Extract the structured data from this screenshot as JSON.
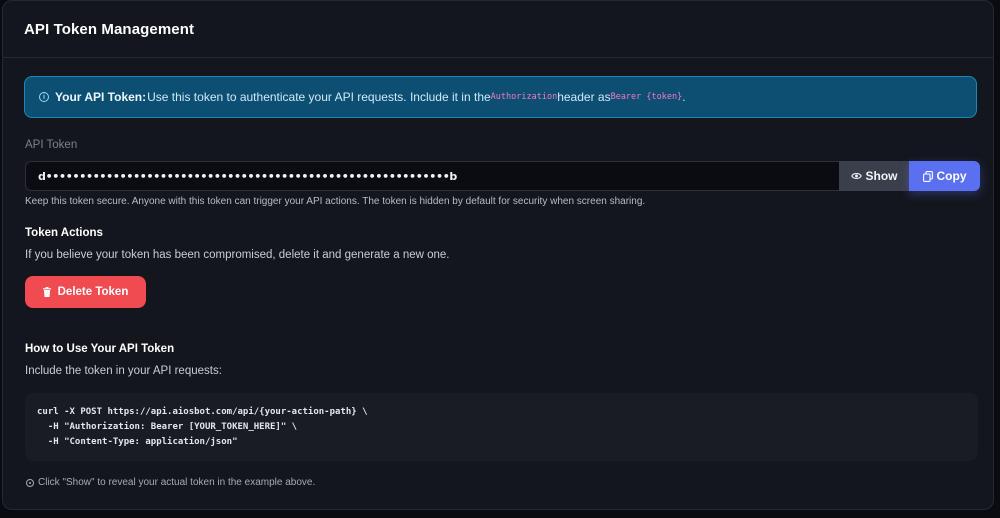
{
  "header": {
    "title": "API Token Management"
  },
  "alert": {
    "icon": "info-icon",
    "strong": "Your API Token:",
    "text_1": "Use this token to authenticate your API requests. Include it in the",
    "code_1": "Authorization",
    "text_2": "header as",
    "code_2": "Bearer {token}",
    "text_3": "."
  },
  "token": {
    "label": "API Token",
    "masked_value": "d••••••••••••••••••••••••••••••••••••••••••••••••••••••••••••b",
    "show_label": "Show",
    "show_icon": "eye-icon",
    "copy_label": "Copy",
    "copy_icon": "copy-icon",
    "hint": "Keep this token secure. Anyone with this token can trigger your API actions. The token is hidden by default for security when screen sharing."
  },
  "actions": {
    "title": "Token Actions",
    "description": "If you believe your token has been compromised, delete it and generate a new one.",
    "delete_label": "Delete Token",
    "delete_icon": "trash-icon"
  },
  "usage": {
    "title": "How to Use Your API Token",
    "description": "Include the token in your API requests:",
    "code_lines": [
      "curl -X POST https://api.aiosbot.com/api/{your-action-path} \\",
      "  -H \"Authorization: Bearer [YOUR_TOKEN_HERE]\" \\",
      "  -H \"Content-Type: application/json\""
    ],
    "footnote": "Click \"Show\" to reveal your actual token in the example above.",
    "footnote_icon": "lightbulb-icon"
  },
  "colors": {
    "background": "#0a0b10",
    "card": "#14161e",
    "alert_bg": "#0d4f72",
    "alert_border": "#1a88b8",
    "code_pink": "#f07ac4",
    "copy_button": "#5b70f0",
    "show_button": "#3a3f4c",
    "delete_button": "#ef4b51"
  }
}
